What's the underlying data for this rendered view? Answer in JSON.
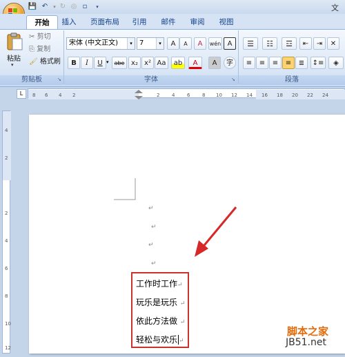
{
  "window": {
    "title": "文"
  },
  "tabs": [
    "开始",
    "插入",
    "页面布局",
    "引用",
    "邮件",
    "审阅",
    "视图"
  ],
  "clipboard": {
    "paste_label": "粘贴",
    "cut_label": "剪切",
    "copy_label": "复制",
    "format_painter_label": "格式刷",
    "group_label": "剪贴板"
  },
  "font": {
    "font_name": "宋体 (中文正文)",
    "font_size": "7",
    "group_label": "字体",
    "bold": "B",
    "italic": "I",
    "underline": "U",
    "strike": "abe",
    "subscript": "x₂",
    "superscript": "x²",
    "change_case": "Aa",
    "grow": "A",
    "shrink": "A",
    "clear_format": "A",
    "phonetic": "wén",
    "char_border": "A",
    "char_shading": "A",
    "enclose": "字",
    "highlight": "ab",
    "font_color": "A"
  },
  "paragraph": {
    "group_label": "段落"
  },
  "document": {
    "lines": [
      "工作时工作",
      "玩乐是玩乐",
      "依此方法做",
      "轻松与欢乐"
    ],
    "para_mark": "↵"
  },
  "watermark": {
    "text": "脚本之家",
    "url": "JB51.net"
  },
  "colors": {
    "accent": "#15428b",
    "highlight_box": "#c8322d",
    "arrow": "#d62828"
  }
}
